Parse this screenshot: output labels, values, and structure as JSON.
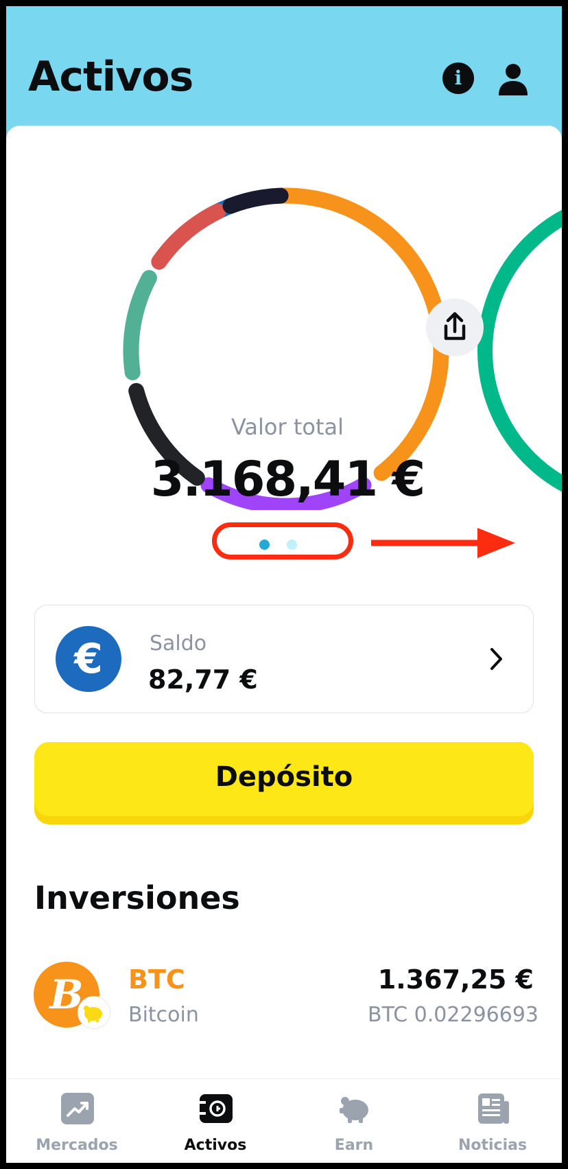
{
  "header": {
    "title": "Activos",
    "info_icon_glyph": "i"
  },
  "portfolio": {
    "label": "Valor total",
    "total_value": "3.168,41 €",
    "segment_colors": [
      "#1c6bbf",
      "#f7931a",
      "#9f44f8",
      "#212327",
      "#52b195",
      "#d9534f",
      "#1a1a2e"
    ],
    "next_page_color": "#00b88a",
    "pager_count": 2,
    "pager_active": 1,
    "pager_colors": {
      "active": "#22a9d6",
      "inactive": "#bff0fb"
    },
    "annotation_color": "#fb2c10"
  },
  "balance": {
    "label": "Saldo",
    "value": "82,77 €",
    "currency_symbol": "€"
  },
  "deposit": {
    "label": "Depósito"
  },
  "investments": {
    "title": "Inversiones",
    "items": [
      {
        "symbol": "BTC",
        "name": "Bitcoin",
        "value": "1.367,25 €",
        "amount": "BTC 0.02296693",
        "icon_glyph": "B",
        "color": "#f7931a"
      }
    ]
  },
  "nav": {
    "items": [
      {
        "label": "Mercados",
        "icon": "chart-icon",
        "active": false
      },
      {
        "label": "Activos",
        "icon": "wallet-icon",
        "active": true
      },
      {
        "label": "Earn",
        "icon": "piggy-bank-icon",
        "active": false
      },
      {
        "label": "Noticias",
        "icon": "newspaper-icon",
        "active": false
      }
    ],
    "active_color": "#0c0d0f",
    "inactive_color": "#9aa3ae"
  }
}
